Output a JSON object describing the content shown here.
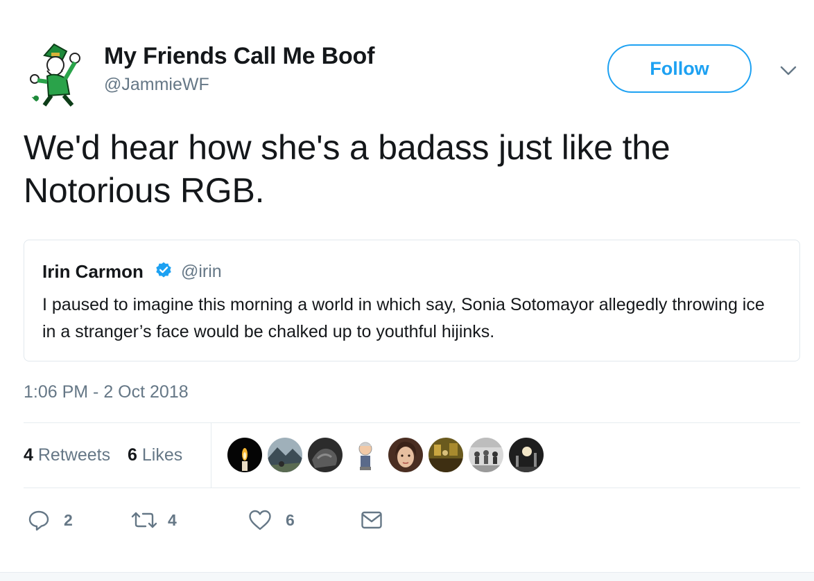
{
  "author": {
    "display_name": "My Friends Call Me Boof",
    "handle": "@JammieWF",
    "avatar_icon": "leprechaun-mascot-avatar"
  },
  "follow_label": "Follow",
  "tweet_text": "We'd hear how she's a badass just like the Notorious RGB.",
  "quoted_tweet": {
    "display_name": "Irin Carmon",
    "handle": "@irin",
    "verified_icon": "verified-badge-icon",
    "text": "I paused to imagine this morning a world in which say, Sonia Sotomayor allegedly throwing ice in a stranger’s face would be chalked up to youthful hijinks."
  },
  "timestamp": "1:06 PM - 2 Oct 2018",
  "stats": {
    "retweets_count": "4",
    "retweets_label": "Retweets",
    "likes_count": "6",
    "likes_label": "Likes"
  },
  "likers": [
    {
      "icon": "candle-avatar"
    },
    {
      "icon": "mountain-landscape-avatar"
    },
    {
      "icon": "dark-photo-avatar"
    },
    {
      "icon": "bobblehead-avatar"
    },
    {
      "icon": "woman-portrait-avatar"
    },
    {
      "icon": "bar-interior-avatar"
    },
    {
      "icon": "group-photo-avatar"
    },
    {
      "icon": "night-street-avatar"
    }
  ],
  "actions": {
    "reply_count": "2",
    "retweet_count": "4",
    "like_count": "6"
  },
  "colors": {
    "accent": "#1da1f2",
    "secondary_text": "#657786",
    "verified": "#1da1f2"
  }
}
